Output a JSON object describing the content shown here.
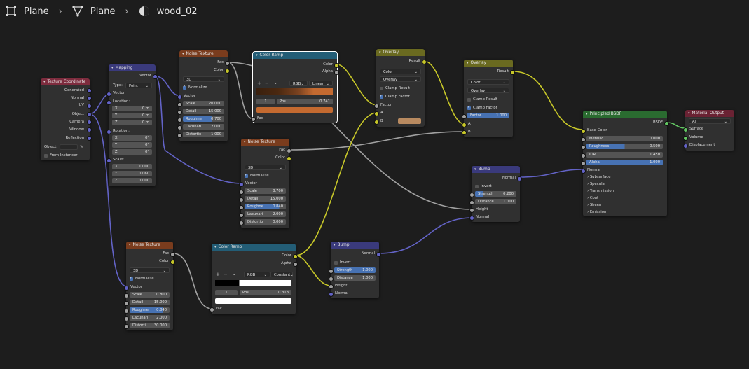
{
  "breadcrumb": {
    "items": [
      {
        "label": "Plane",
        "icon": "object-icon"
      },
      {
        "label": "Plane",
        "icon": "mesh-icon"
      },
      {
        "label": "wood_02",
        "icon": "material-icon"
      }
    ],
    "separator": "›"
  },
  "colors": {
    "texture": "#7a3c1d",
    "input": "#7e2c3e",
    "vector": "#3a3a7c",
    "converter": "#235d76",
    "color": "#6a6a20",
    "shader": "#2a6b30",
    "output": "#6a2233",
    "wire_yellow": "#c7c729",
    "wire_blue": "#6363c7",
    "wire_gray": "#a1a1a1"
  },
  "tex_coord": {
    "title": "Texture Coordinate",
    "outputs": [
      "Generated",
      "Normal",
      "UV",
      "Object",
      "Camera",
      "Window",
      "Reflection"
    ],
    "object_label": "Object:",
    "from_instancer": "From Instancer"
  },
  "mapping": {
    "title": "Mapping",
    "vector_out": "Vector",
    "type_label": "Type:",
    "type_value": "Point",
    "vector_in": "Vector",
    "location": "Location:",
    "rotation": "Rotation:",
    "scale": "Scale:",
    "loc": [
      {
        "k": "X",
        "v": "0 m"
      },
      {
        "k": "Y",
        "v": "0 m"
      },
      {
        "k": "Z",
        "v": "0 m"
      }
    ],
    "rot": [
      {
        "k": "X",
        "v": "0°"
      },
      {
        "k": "Y",
        "v": "0°"
      },
      {
        "k": "Z",
        "v": "0°"
      }
    ],
    "scl": [
      {
        "k": "X",
        "v": "1.000"
      },
      {
        "k": "Y",
        "v": "0.060"
      },
      {
        "k": "Z",
        "v": "0.000"
      }
    ]
  },
  "noise1": {
    "title": "Noise Texture",
    "fac": "Fac",
    "color": "Color",
    "dim": "3D",
    "normalize": "Normalize",
    "vector": "Vector",
    "fields": [
      {
        "k": "Scale",
        "v": "20.000"
      },
      {
        "k": "Detail",
        "v": "15.000"
      },
      {
        "k": "Roughne",
        "v": "0.700"
      },
      {
        "k": "Lacunari",
        "v": "2.000"
      },
      {
        "k": "Distortio",
        "v": "1.000"
      }
    ]
  },
  "ramp1": {
    "title": "Color Ramp",
    "color": "Color",
    "alpha": "Alpha",
    "mode": "RGB",
    "interp": "Linear",
    "index": "1",
    "pos_label": "Pos",
    "pos": "0.741",
    "fac": "Fac"
  },
  "overlay1": {
    "title": "Overlay",
    "result": "Result",
    "op1": "Color",
    "op2": "Overlay",
    "clamp_result": "Clamp Result",
    "clamp_factor": "Clamp Factor",
    "factor": "Factor",
    "a": "A",
    "b": "B"
  },
  "overlay2": {
    "title": "Overlay",
    "result": "Result",
    "op1": "Color",
    "op2": "Overlay",
    "clamp_result": "Clamp Result",
    "clamp_factor": "Clamp Factor",
    "factor_label": "Factor",
    "factor_val": "1.000",
    "a": "A",
    "b": "B"
  },
  "noise2": {
    "title": "Noise Texture",
    "fac": "Fac",
    "color": "Color",
    "dim": "3D",
    "normalize": "Normalize",
    "vector": "Vector",
    "fields": [
      {
        "k": "Scale",
        "v": "8.700"
      },
      {
        "k": "Detail",
        "v": "15.000"
      },
      {
        "k": "Roughne",
        "v": "0.840"
      },
      {
        "k": "Lacunari",
        "v": "2.000"
      },
      {
        "k": "Distortio",
        "v": "0.000"
      }
    ]
  },
  "bump1": {
    "title": "Bump",
    "normal_out": "Normal",
    "invert": "Invert",
    "strength_label": "Strength",
    "strength": "0.200",
    "distance_label": "Distance",
    "distance": "1.000",
    "height": "Height",
    "normal_in": "Normal"
  },
  "bsdf": {
    "title": "Principled BSDF",
    "bsdf": "BSDF",
    "base_color": "Base Color",
    "fields": [
      {
        "k": "Metallic",
        "v": "0.000"
      },
      {
        "k": "Roughness",
        "v": "0.500"
      },
      {
        "k": "IOR",
        "v": "1.450"
      },
      {
        "k": "Alpha",
        "v": "1.000"
      }
    ],
    "normal": "Normal",
    "panels": [
      "Subsurface",
      "Specular",
      "Transmission",
      "Coat",
      "Sheen",
      "Emission"
    ]
  },
  "output": {
    "title": "Material Output",
    "target": "All",
    "surface": "Surface",
    "volume": "Volume",
    "displacement": "Displacement"
  },
  "noise3": {
    "title": "Noise Texture",
    "fac": "Fac",
    "color": "Color",
    "dim": "3D",
    "normalize": "Normalize",
    "vector": "Vector",
    "fields": [
      {
        "k": "Scale",
        "v": "0.800"
      },
      {
        "k": "Detail",
        "v": "15.000"
      },
      {
        "k": "Roughne",
        "v": "0.840"
      },
      {
        "k": "Lacunari",
        "v": "2.000"
      },
      {
        "k": "Distorti",
        "v": "30.000"
      }
    ]
  },
  "ramp2": {
    "title": "Color Ramp",
    "color": "Color",
    "alpha": "Alpha",
    "mode": "RGB",
    "interp": "Constant",
    "index": "1",
    "pos_label": "Pos",
    "pos": "0.318",
    "fac": "Fac"
  },
  "bump2": {
    "title": "Bump",
    "normal_out": "Normal",
    "invert": "Invert",
    "strength_label": "Strength",
    "strength": "1.000",
    "distance_label": "Distance",
    "distance": "1.000",
    "height": "Height",
    "normal_in": "Normal"
  }
}
